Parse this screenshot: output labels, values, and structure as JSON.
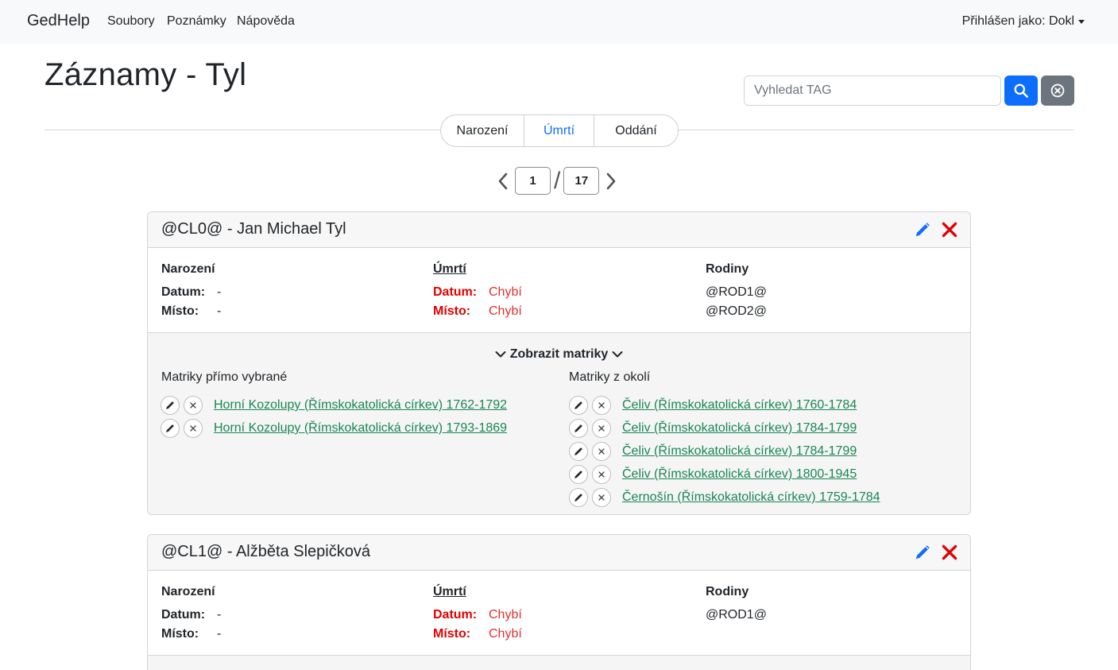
{
  "navbar": {
    "brand": "GedHelp",
    "links": [
      "Soubory",
      "Poznámky",
      "Nápověda"
    ],
    "user": "Přihlášen jako: Dokl"
  },
  "page_title": "Záznamy - Tyl",
  "search": {
    "placeholder": "Vyhledat TAG"
  },
  "tabs": [
    {
      "label": "Narození",
      "active": false
    },
    {
      "label": "Úmrtí",
      "active": true
    },
    {
      "label": "Oddání",
      "active": false
    }
  ],
  "pagination": {
    "current": "1",
    "separator": "/",
    "total": "17"
  },
  "labels": {
    "birth": "Narození",
    "death": "Úmrtí",
    "families": "Rodiny",
    "date": "Datum:",
    "place": "Místo:",
    "show_registers": "Zobrazit matriky",
    "direct_registers": "Matriky přímo vybrané",
    "nearby_registers": "Matriky z okolí"
  },
  "records": [
    {
      "title": "@CL0@ - Jan Michael Tyl",
      "birth": {
        "date": "-",
        "place": "-"
      },
      "death": {
        "date": "Chybí",
        "place": "Chybí"
      },
      "families": [
        "@ROD1@",
        "@ROD2@"
      ],
      "direct_registers": [
        "Horní Kozolupy (Římskokatolická církev) 1762-1792",
        "Horní Kozolupy (Římskokatolická církev) 1793-1869"
      ],
      "nearby_registers": [
        "Čeliv (Římskokatolická církev) 1760-1784",
        "Čeliv (Římskokatolická církev) 1784-1799",
        "Čeliv (Římskokatolická církev) 1784-1799",
        "Čeliv (Římskokatolická církev) 1800-1945",
        "Černošín (Římskokatolická církev) 1759-1784"
      ]
    },
    {
      "title": "@CL1@ - Alžběta Slepičková",
      "birth": {
        "date": "-",
        "place": "-"
      },
      "death": {
        "date": "Chybí",
        "place": "Chybí"
      },
      "families": [
        "@ROD1@"
      ]
    }
  ]
}
